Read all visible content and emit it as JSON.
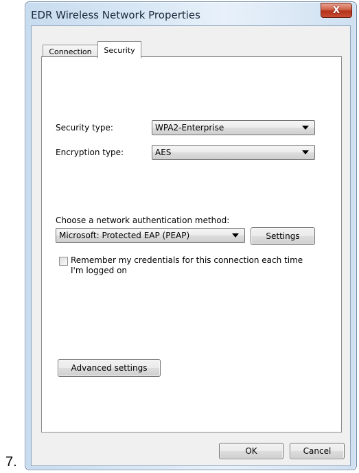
{
  "step_number": "7.",
  "window": {
    "title": "EDR Wireless Network Properties",
    "close_label": "X"
  },
  "tabs": [
    {
      "label": "Connection",
      "selected": false
    },
    {
      "label": "Security",
      "selected": true
    }
  ],
  "security": {
    "security_type_label": "Security type:",
    "security_type_value": "WPA2-Enterprise",
    "encryption_type_label": "Encryption type:",
    "encryption_type_value": "AES",
    "auth_method_label": "Choose a network authentication method:",
    "auth_method_value": "Microsoft: Protected EAP (PEAP)",
    "settings_button": "Settings",
    "remember_label": "Remember my credentials for this connection each time I'm logged on",
    "remember_checked": false,
    "advanced_button": "Advanced settings"
  },
  "footer": {
    "ok_button": "OK",
    "cancel_button": "Cancel"
  }
}
